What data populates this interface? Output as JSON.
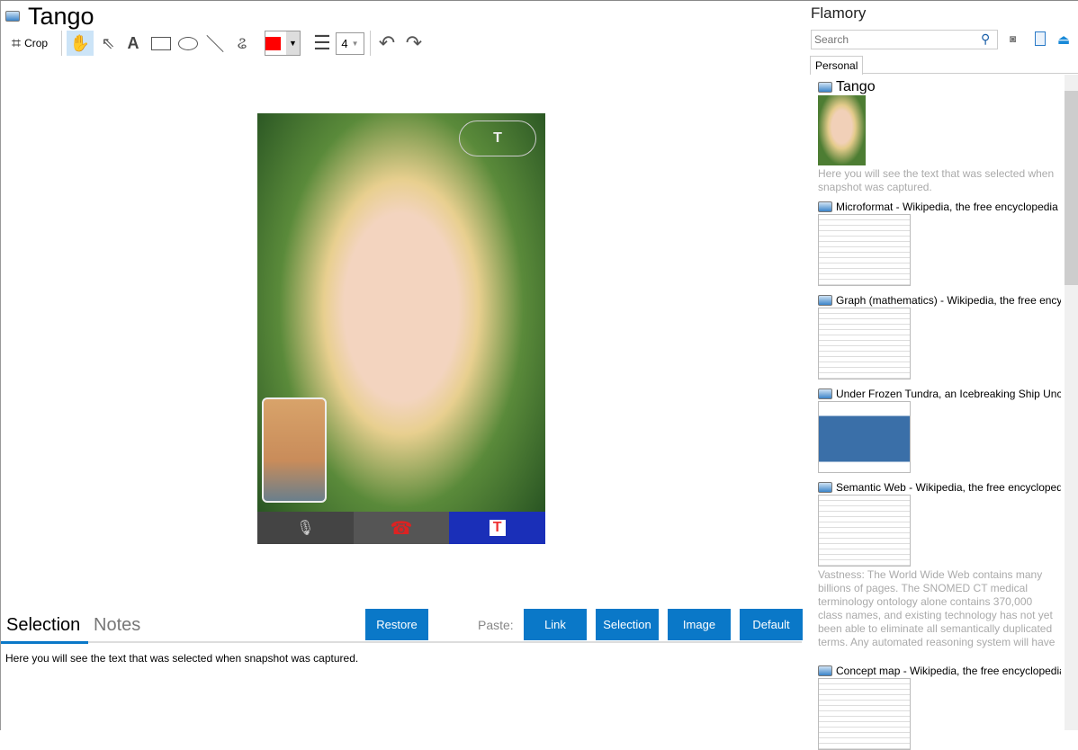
{
  "window": {
    "title": "Tango"
  },
  "toolbar": {
    "crop_label": "Crop",
    "line_width": "4",
    "color": "#ff0000"
  },
  "bottom": {
    "tabs": [
      {
        "label": "Selection",
        "active": true
      },
      {
        "label": "Notes",
        "active": false
      }
    ],
    "restore_label": "Restore",
    "paste_label": "Paste:",
    "paste_buttons": [
      "Link",
      "Selection",
      "Image",
      "Default"
    ],
    "selection_text": "Here you will see the text that was selected when snapshot was captured."
  },
  "sidebar": {
    "app_name": "Flamory",
    "search_placeholder": "Search",
    "tab": "Personal",
    "items": [
      {
        "title": "Tango",
        "text": "Here you will see the text that was selected when snapshot was captured."
      },
      {
        "title": "Microformat - Wikipedia, the free encyclopedia"
      },
      {
        "title": "Graph (mathematics) - Wikipedia, the free encyclopedia"
      },
      {
        "title": "Under Frozen Tundra, an Icebreaking Ship Uncovers"
      },
      {
        "title": "Semantic Web - Wikipedia, the free encyclopedia",
        "text": "Vastness: The World Wide Web contains many billions of pages. The SNOMED CT medical terminology ontology alone contains 370,000 class names, and existing technology has not yet been able to eliminate all semantically duplicated terms. Any automated reasoning system will have to deal with truly huge inputs."
      },
      {
        "title": "Concept map - Wikipedia, the free encyclopedia"
      }
    ]
  }
}
